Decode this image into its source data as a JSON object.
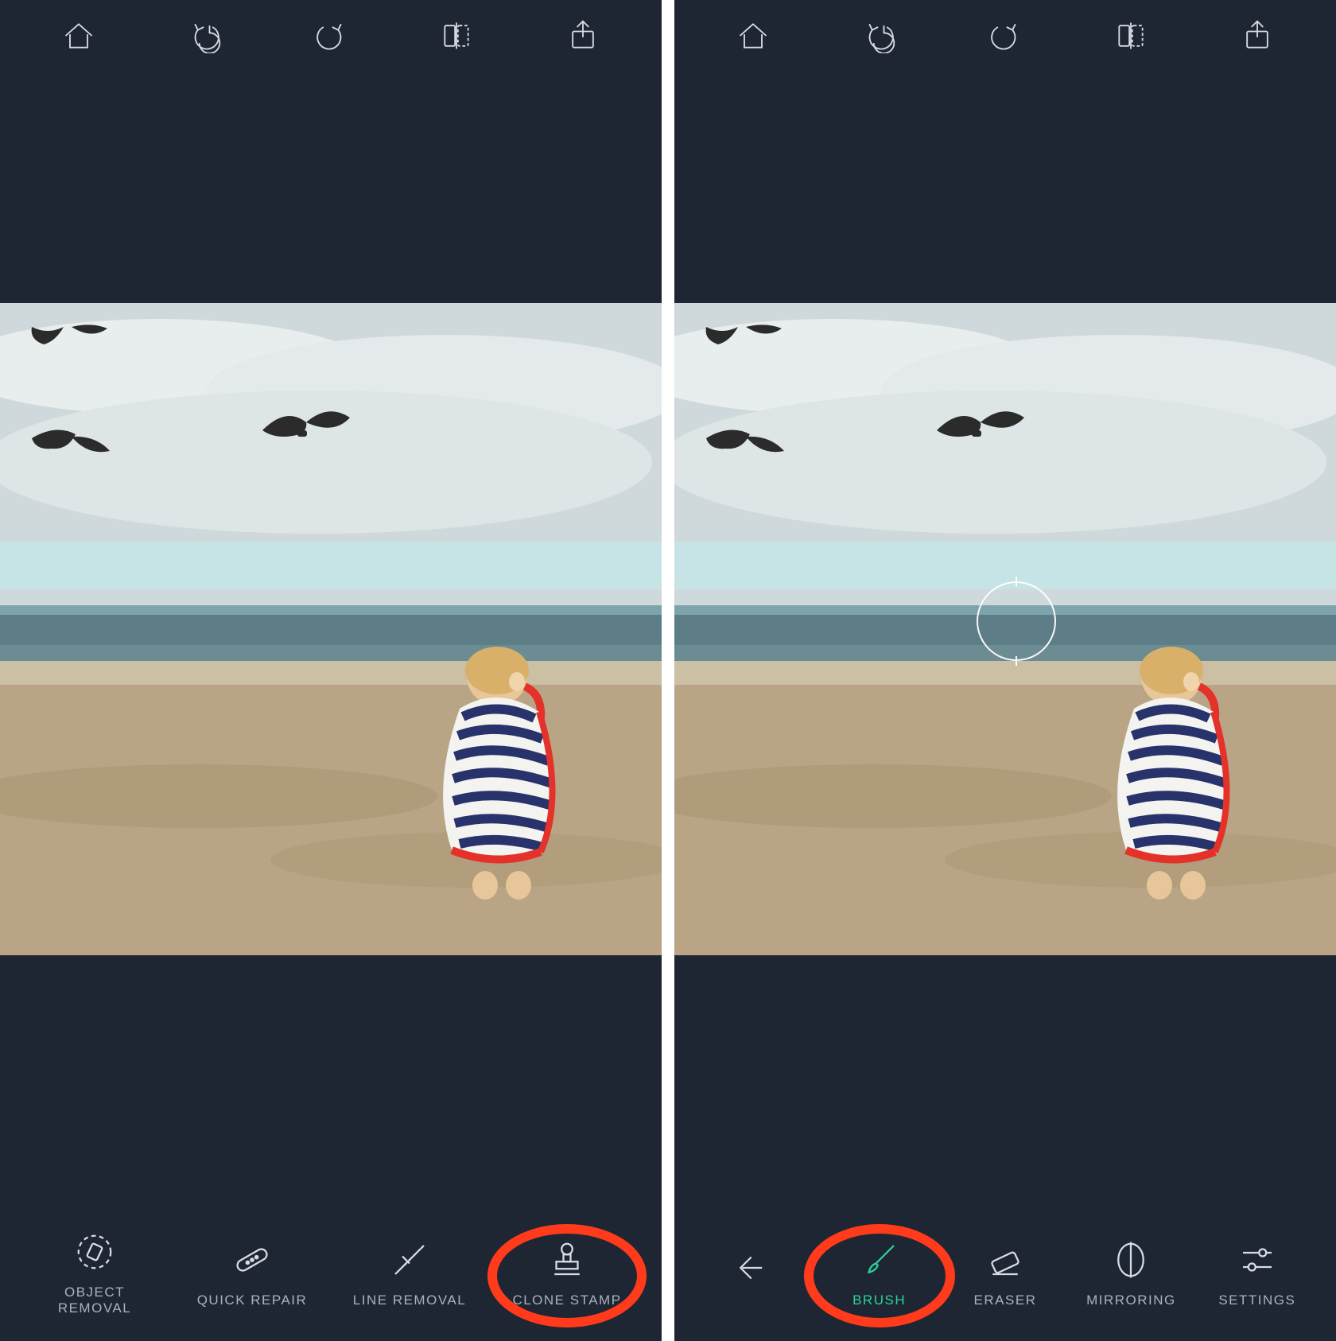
{
  "colors": {
    "bg": "#1f2633",
    "icon": "#d7dde6",
    "accent": "#2bd39a",
    "highlight": "#ff3b1c"
  },
  "topbar_icons": {
    "home": "home-icon",
    "undo": "undo-icon",
    "redo": "redo-icon",
    "compare": "compare-icon",
    "share": "share-icon"
  },
  "left": {
    "tools": [
      {
        "key": "object-removal",
        "label": "OBJECT REMOVAL",
        "icon": "object-removal-icon",
        "active": false
      },
      {
        "key": "quick-repair",
        "label": "QUICK REPAIR",
        "icon": "bandage-icon",
        "active": false
      },
      {
        "key": "line-removal",
        "label": "LINE REMOVAL",
        "icon": "line-removal-icon",
        "active": false
      },
      {
        "key": "clone-stamp",
        "label": "CLONE STAMP",
        "icon": "stamp-icon",
        "active": false,
        "highlighted": true
      }
    ]
  },
  "right": {
    "tools": [
      {
        "key": "back",
        "label": "",
        "icon": "back-icon",
        "active": false
      },
      {
        "key": "brush",
        "label": "BRUSH",
        "icon": "brush-icon",
        "active": true,
        "highlighted": true
      },
      {
        "key": "eraser",
        "label": "ERASER",
        "icon": "eraser-icon",
        "active": false
      },
      {
        "key": "mirroring",
        "label": "MIRRORING",
        "icon": "mirror-icon",
        "active": false
      },
      {
        "key": "settings",
        "label": "SETTINGS",
        "icon": "sliders-icon",
        "active": false
      }
    ],
    "reticle_visible": true
  }
}
